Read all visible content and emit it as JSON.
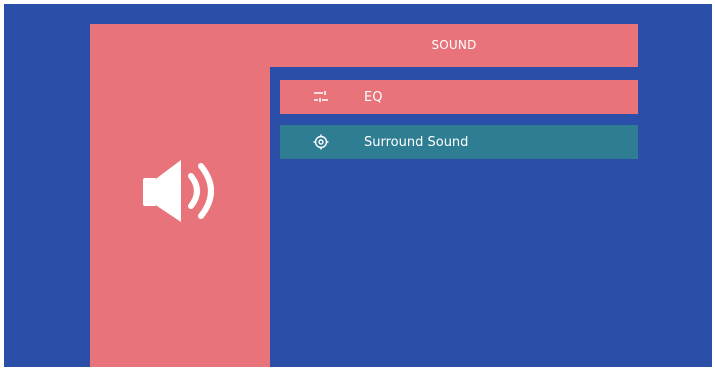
{
  "header": {
    "title": "SOUND"
  },
  "side_panel": {
    "icon": "speaker-icon"
  },
  "menu": {
    "items": [
      {
        "label": "EQ",
        "icon": "equalizer-icon",
        "selected": true
      },
      {
        "label": "Surround Sound",
        "icon": "surround-sound-icon",
        "selected": false
      }
    ]
  },
  "colors": {
    "background": "#2b4fa8",
    "accent": "#e8737a",
    "surround_row": "#2f7d92",
    "text": "#ffffff"
  }
}
